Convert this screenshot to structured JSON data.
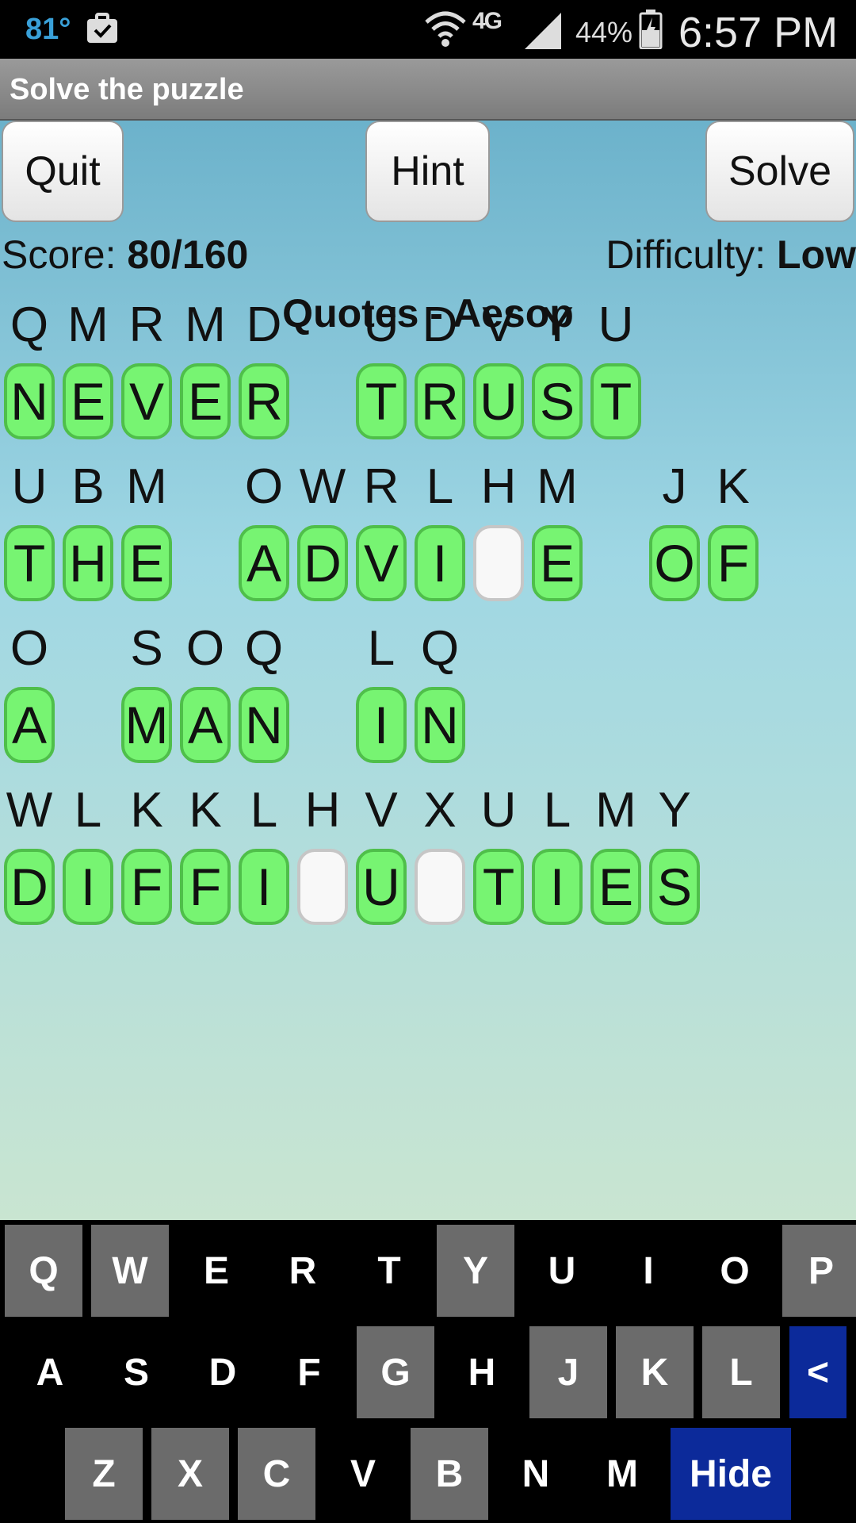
{
  "status_bar": {
    "temperature": "81°",
    "network": "4G",
    "battery": "44%",
    "time": "6:57 PM",
    "icons": [
      "briefcase-check-icon",
      "wifi-icon",
      "signal-icon",
      "battery-charging-icon"
    ]
  },
  "title": "Solve the puzzle",
  "buttons": {
    "quit": "Quit",
    "hint": "Hint",
    "solve": "Solve"
  },
  "score": {
    "label": "Score: ",
    "value": "80/160"
  },
  "difficulty": {
    "label": "Difficulty: ",
    "value": "Low"
  },
  "category": "Quotes - Aesop",
  "rows": [
    [
      {
        "cipher": "Q",
        "plain": "N"
      },
      {
        "cipher": "M",
        "plain": "E"
      },
      {
        "cipher": "R",
        "plain": "V"
      },
      {
        "cipher": "M",
        "plain": "E"
      },
      {
        "cipher": "D",
        "plain": "R"
      },
      null,
      {
        "cipher": "U",
        "plain": "T"
      },
      {
        "cipher": "D",
        "plain": "R"
      },
      {
        "cipher": "V",
        "plain": "U"
      },
      {
        "cipher": "Y",
        "plain": "S"
      },
      {
        "cipher": "U",
        "plain": "T"
      }
    ],
    [
      {
        "cipher": "U",
        "plain": "T"
      },
      {
        "cipher": "B",
        "plain": "H"
      },
      {
        "cipher": "M",
        "plain": "E"
      },
      null,
      {
        "cipher": "O",
        "plain": "A"
      },
      {
        "cipher": "W",
        "plain": "D"
      },
      {
        "cipher": "R",
        "plain": "V"
      },
      {
        "cipher": "L",
        "plain": "I"
      },
      {
        "cipher": "H",
        "plain": ""
      },
      {
        "cipher": "M",
        "plain": "E"
      },
      null,
      {
        "cipher": "J",
        "plain": "O"
      },
      {
        "cipher": "K",
        "plain": "F"
      }
    ],
    [
      {
        "cipher": "O",
        "plain": "A"
      },
      null,
      {
        "cipher": "S",
        "plain": "M"
      },
      {
        "cipher": "O",
        "plain": "A"
      },
      {
        "cipher": "Q",
        "plain": "N"
      },
      null,
      {
        "cipher": "L",
        "plain": "I"
      },
      {
        "cipher": "Q",
        "plain": "N"
      }
    ],
    [
      {
        "cipher": "W",
        "plain": "D"
      },
      {
        "cipher": "L",
        "plain": "I"
      },
      {
        "cipher": "K",
        "plain": "F"
      },
      {
        "cipher": "K",
        "plain": "F"
      },
      {
        "cipher": "L",
        "plain": "I"
      },
      {
        "cipher": "H",
        "plain": ""
      },
      {
        "cipher": "V",
        "plain": "U"
      },
      {
        "cipher": "X",
        "plain": ""
      },
      {
        "cipher": "U",
        "plain": "T"
      },
      {
        "cipher": "L",
        "plain": "I"
      },
      {
        "cipher": "M",
        "plain": "E"
      },
      {
        "cipher": "Y",
        "plain": "S"
      }
    ]
  ],
  "keyboard": {
    "row1": [
      {
        "k": "Q",
        "used": true
      },
      {
        "k": "W",
        "used": true
      },
      {
        "k": "E",
        "used": false
      },
      {
        "k": "R",
        "used": false
      },
      {
        "k": "T",
        "used": false
      },
      {
        "k": "Y",
        "used": true
      },
      {
        "k": "U",
        "used": false
      },
      {
        "k": "I",
        "used": false
      },
      {
        "k": "O",
        "used": false
      },
      {
        "k": "P",
        "used": true
      }
    ],
    "row2": [
      {
        "k": "A",
        "used": false
      },
      {
        "k": "S",
        "used": false
      },
      {
        "k": "D",
        "used": false
      },
      {
        "k": "F",
        "used": false
      },
      {
        "k": "G",
        "used": true
      },
      {
        "k": "H",
        "used": false
      },
      {
        "k": "J",
        "used": true
      },
      {
        "k": "K",
        "used": true
      },
      {
        "k": "L",
        "used": true
      },
      {
        "k": "<",
        "used": false,
        "special": true
      }
    ],
    "row3": [
      {
        "k": "Z",
        "used": true
      },
      {
        "k": "X",
        "used": true
      },
      {
        "k": "C",
        "used": true
      },
      {
        "k": "V",
        "used": false
      },
      {
        "k": "B",
        "used": true
      },
      {
        "k": "N",
        "used": false
      },
      {
        "k": "M",
        "used": false
      },
      {
        "k": "Hide",
        "used": false,
        "special": true
      }
    ]
  },
  "colors": {
    "tile_filled": "#77f472",
    "tile_empty": "#f8f8f8",
    "key_used": "#6b6b6b",
    "key_special": "#0c2a9a"
  }
}
